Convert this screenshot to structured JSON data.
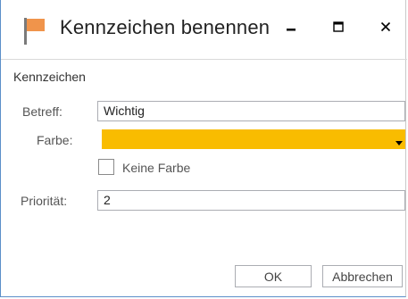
{
  "window": {
    "title": "Kennzeichen benennen",
    "icon": "flag-icon"
  },
  "titlebar_buttons": {
    "minimize": "minimize-icon",
    "maximize": "maximize-icon",
    "close": "close-icon"
  },
  "form": {
    "section_label": "Kennzeichen",
    "betreff_label": "Betreff:",
    "betreff_value": "Wichtig",
    "farbe_label": "Farbe:",
    "farbe_color": "#F9BC00",
    "keine_farbe_label": "Keine Farbe",
    "keine_farbe_checked": false,
    "prioritaet_label": "Priorität:",
    "prioritaet_value": "2"
  },
  "buttons": {
    "ok_label": "OK",
    "cancel_label": "Abbrechen"
  },
  "colors": {
    "flag": "#F0944B",
    "window_border": "#5B8FC9",
    "selected_color": "#F9BC00"
  }
}
